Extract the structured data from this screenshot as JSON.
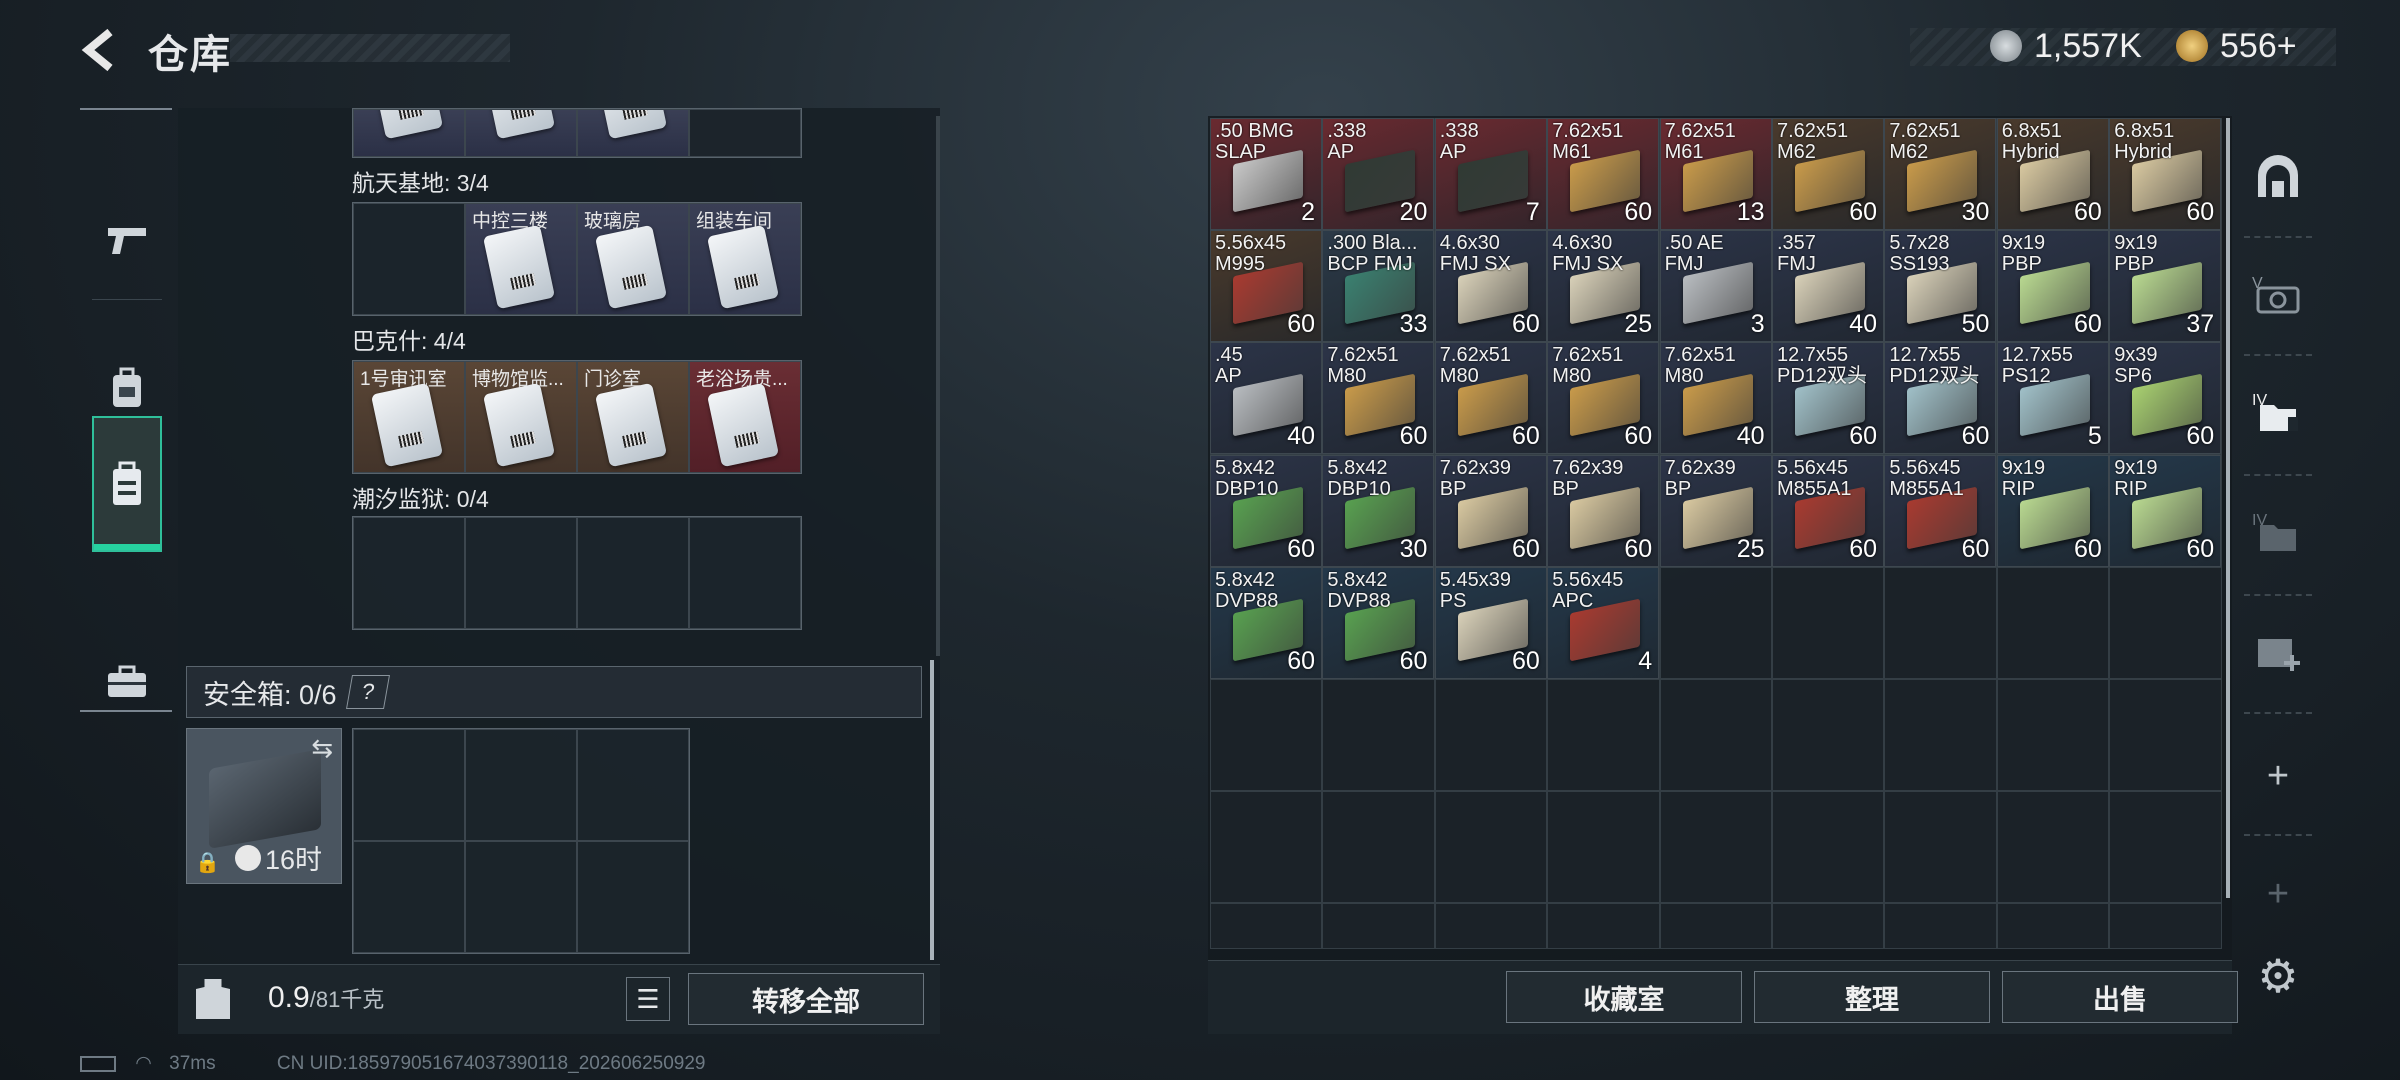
{
  "header": {
    "title": "仓库"
  },
  "currency": {
    "silver": "1,557K",
    "gold": "556+"
  },
  "nav": [
    "gun-icon",
    "backpack-icon",
    "storage-icon",
    "briefcase-icon"
  ],
  "sections": [
    {
      "label": "航天基地: 3/4",
      "keys": [
        "",
        "中控三楼",
        "玻璃房",
        "组装车间"
      ],
      "colors": [
        "empty",
        "purple",
        "purple",
        "purple"
      ]
    },
    {
      "label": "巴克什: 4/4",
      "keys": [
        "1号审讯室",
        "博物馆监...",
        "门诊室",
        "老浴场贵..."
      ],
      "colors": [
        "brown",
        "brown",
        "brown",
        "red"
      ]
    },
    {
      "label": "潮汐监狱: 0/4",
      "keys": [
        "",
        "",
        "",
        ""
      ],
      "colors": [
        "empty",
        "empty",
        "empty",
        "empty"
      ]
    }
  ],
  "safe": {
    "label": "安全箱: 0/6",
    "help": "?",
    "timer": "16时"
  },
  "weight": {
    "value": "0.9",
    "max": "/81千克"
  },
  "buttons": {
    "transfer_all": "转移全部",
    "collection": "收藏室",
    "organize": "整理",
    "sell": "出售"
  },
  "ammo": [
    {
      "name": ".50 BMG\nSLAP",
      "qty": "2",
      "bg": "#6a2a30",
      "box": "#c8c8c8"
    },
    {
      "name": ".338\nAP",
      "qty": "20",
      "bg": "#6a2a30",
      "box": "#303a34"
    },
    {
      "name": ".338\nAP",
      "qty": "7",
      "bg": "#6a2a30",
      "box": "#303a34"
    },
    {
      "name": "7.62x51\nM61",
      "qty": "60",
      "bg": "#6a2a30",
      "box": "#c89a4a"
    },
    {
      "name": "7.62x51\nM61",
      "qty": "13",
      "bg": "#6a2a30",
      "box": "#c89a4a"
    },
    {
      "name": "7.62x51\nM62",
      "qty": "60",
      "bg": "#4a3a2c",
      "box": "#c89a4a"
    },
    {
      "name": "7.62x51\nM62",
      "qty": "30",
      "bg": "#4a3a2c",
      "box": "#c89a4a"
    },
    {
      "name": "6.8x51\nHybrid",
      "qty": "60",
      "bg": "#4a3a2c",
      "box": "#d8c8a0"
    },
    {
      "name": "6.8x51\nHybrid",
      "qty": "60",
      "bg": "#4a3a2c",
      "box": "#d8c8a0"
    },
    {
      "name": "5.56x45\nM995",
      "qty": "60",
      "bg": "#4a3a2c",
      "box": "#a83a30"
    },
    {
      "name": ".300 Bla...\nBCP FMJ",
      "qty": "33",
      "bg": "#2c3a48",
      "box": "#3a8070"
    },
    {
      "name": "4.6x30\nFMJ SX",
      "qty": "60",
      "bg": "#2c3448",
      "box": "#d8d0b8"
    },
    {
      "name": "4.6x30\nFMJ SX",
      "qty": "25",
      "bg": "#2c3448",
      "box": "#d8d0b8"
    },
    {
      "name": ".50 AE\nFMJ",
      "qty": "3",
      "bg": "#2c3448",
      "box": "#b8bcc0"
    },
    {
      "name": ".357\nFMJ",
      "qty": "40",
      "bg": "#2c3448",
      "box": "#d8d0b8"
    },
    {
      "name": "5.7x28\nSS193",
      "qty": "50",
      "bg": "#2c3448",
      "box": "#d8d0b8"
    },
    {
      "name": "9x19\nPBP",
      "qty": "60",
      "bg": "#2c3448",
      "box": "#b8d890"
    },
    {
      "name": "9x19\nPBP",
      "qty": "37",
      "bg": "#2c3448",
      "box": "#b8d890"
    },
    {
      "name": ".45\nAP",
      "qty": "40",
      "bg": "#2c3448",
      "box": "#b8bcc0"
    },
    {
      "name": "7.62x51\nM80",
      "qty": "60",
      "bg": "#2c3448",
      "box": "#c89a4a"
    },
    {
      "name": "7.62x51\nM80",
      "qty": "60",
      "bg": "#2c3448",
      "box": "#c89a4a"
    },
    {
      "name": "7.62x51\nM80",
      "qty": "60",
      "bg": "#2c3448",
      "box": "#c89a4a"
    },
    {
      "name": "7.62x51\nM80",
      "qty": "40",
      "bg": "#2c3448",
      "box": "#c89a4a"
    },
    {
      "name": "12.7x55\nPD12双头",
      "qty": "60",
      "bg": "#2c3448",
      "box": "#a0c0c8"
    },
    {
      "name": "12.7x55\nPD12双头",
      "qty": "60",
      "bg": "#2c3448",
      "box": "#a0c0c8"
    },
    {
      "name": "12.7x55\nPS12",
      "qty": "5",
      "bg": "#2c3448",
      "box": "#a0c0c8"
    },
    {
      "name": "9x39\nSP6",
      "qty": "60",
      "bg": "#2c3448",
      "box": "#a8d070"
    },
    {
      "name": "5.8x42\nDBP10",
      "qty": "60",
      "bg": "#2c3448",
      "box": "#58a050"
    },
    {
      "name": "5.8x42\nDBP10",
      "qty": "30",
      "bg": "#2c3448",
      "box": "#58a050"
    },
    {
      "name": "7.62x39\nBP",
      "qty": "60",
      "bg": "#2c3448",
      "box": "#d8c8a0"
    },
    {
      "name": "7.62x39\nBP",
      "qty": "60",
      "bg": "#2c3448",
      "box": "#d8c8a0"
    },
    {
      "name": "7.62x39\nBP",
      "qty": "25",
      "bg": "#2c3448",
      "box": "#d8c8a0"
    },
    {
      "name": "5.56x45\nM855A1",
      "qty": "60",
      "bg": "#2c3448",
      "box": "#a83a30"
    },
    {
      "name": "5.56x45\nM855A1",
      "qty": "60",
      "bg": "#2c3448",
      "box": "#a83a30"
    },
    {
      "name": "9x19\nRIP",
      "qty": "60",
      "bg": "#24384a",
      "box": "#b8d890"
    },
    {
      "name": "9x19\nRIP",
      "qty": "60",
      "bg": "#24384a",
      "box": "#b8d890"
    },
    {
      "name": "5.8x42\nDVP88",
      "qty": "60",
      "bg": "#24384a",
      "box": "#58a050"
    },
    {
      "name": "5.8x42\nDVP88",
      "qty": "60",
      "bg": "#24384a",
      "box": "#58a050"
    },
    {
      "name": "5.45x39\nPS",
      "qty": "60",
      "bg": "#24384a",
      "box": "#d8d0b8"
    },
    {
      "name": "5.56x45\nAPC",
      "qty": "4",
      "bg": "#24384a",
      "box": "#a83a30"
    }
  ],
  "right_side": [
    "vault-icon",
    "v-storage-icon",
    "iv-storage-icon",
    "iv-storage-dim-icon",
    "add-box-icon",
    "plus-icon",
    "plus-dim-icon"
  ],
  "status": {
    "ping": "37ms",
    "uid": "CN UID:1859790516740373901​18_202606250929"
  }
}
